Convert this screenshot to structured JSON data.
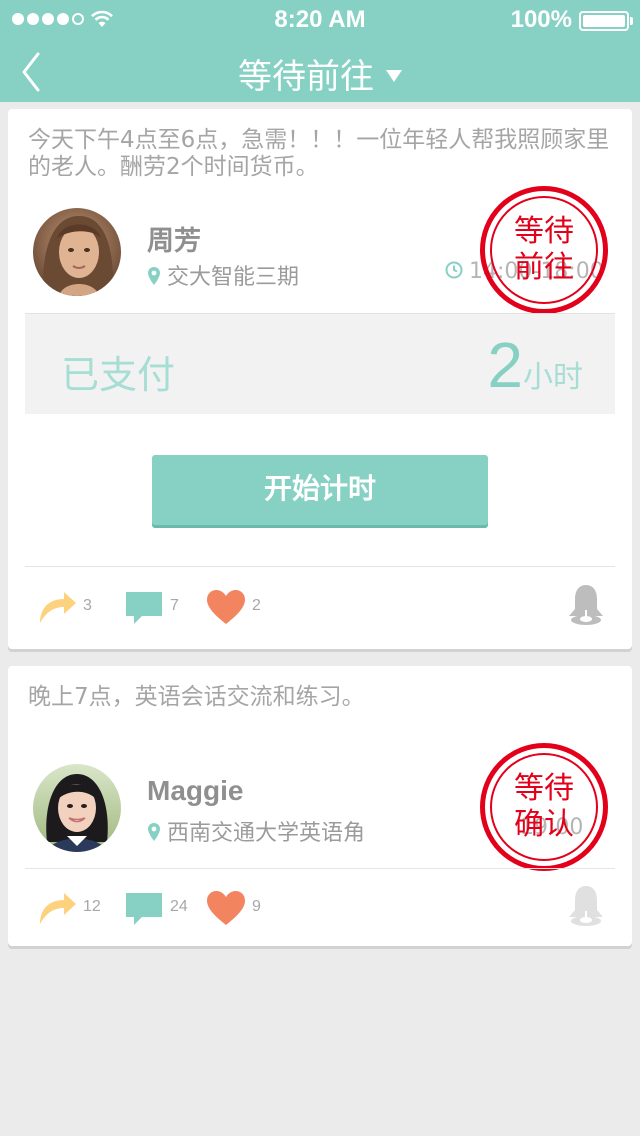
{
  "status_bar": {
    "time": "8:20 AM",
    "battery": "100%"
  },
  "nav": {
    "title": "等待前往"
  },
  "colors": {
    "brand": "#86d1c4",
    "stamp": "#e3001b",
    "share": "#fcd27e",
    "comment": "#86d1c4",
    "like": "#f28560"
  },
  "posts": [
    {
      "description": "今天下午4点至6点，急需！！！一位年轻人帮我照顾家里的老人。酬劳2个时间货币。",
      "user": {
        "name": "周芳",
        "location": "交大智能三期"
      },
      "schedule": "14:00-18:00",
      "stamp": {
        "line1": "等待",
        "line2": "前往"
      },
      "payment": {
        "label": "已支付",
        "amount": "2",
        "unit": "小时"
      },
      "action_button": "开始计时",
      "stats": {
        "shares": "3",
        "comments": "7",
        "likes": "2"
      }
    },
    {
      "description": "晚上7点，英语会话交流和练习。",
      "user": {
        "name": "Maggie",
        "location": "西南交通大学英语角"
      },
      "schedule": "19:00",
      "stamp": {
        "line1": "等待",
        "line2": "确认"
      },
      "stats": {
        "shares": "12",
        "comments": "24",
        "likes": "9"
      }
    }
  ]
}
